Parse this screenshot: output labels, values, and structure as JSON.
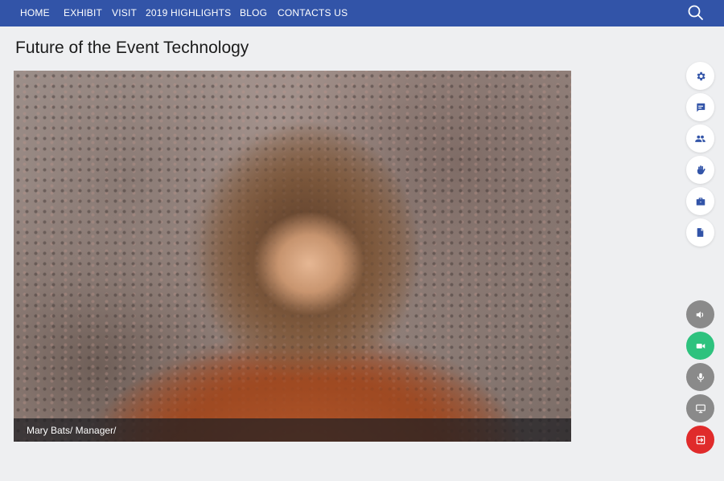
{
  "nav": {
    "items": [
      {
        "label": "HOME"
      },
      {
        "label": "EXHIBIT"
      },
      {
        "label": "VISIT"
      },
      {
        "label": "2019 HIGHLIGHTS"
      },
      {
        "label": "BLOG"
      },
      {
        "label": "CONTACTS US"
      }
    ],
    "search_icon": "search-icon",
    "background": "#3254a8"
  },
  "page": {
    "title": "Future of the Event Technology"
  },
  "video": {
    "caption": "Mary Bats/ Manager/"
  },
  "tools": [
    {
      "icon": "gear-icon",
      "color": "#3254a8"
    },
    {
      "icon": "chat-icon",
      "color": "#3254a8"
    },
    {
      "icon": "people-icon",
      "color": "#3254a8"
    },
    {
      "icon": "raise-hand-icon",
      "color": "#3254a8"
    },
    {
      "icon": "briefcase-icon",
      "color": "#3254a8"
    },
    {
      "icon": "document-icon",
      "color": "#3254a8"
    }
  ],
  "controls": [
    {
      "icon": "speaker-icon",
      "color": "#8a8a8a"
    },
    {
      "icon": "camera-icon",
      "color": "#2ec27e"
    },
    {
      "icon": "microphone-icon",
      "color": "#8a8a8a"
    },
    {
      "icon": "screen-share-icon",
      "color": "#8a8a8a"
    },
    {
      "icon": "exit-icon",
      "color": "#e02b2b"
    }
  ]
}
